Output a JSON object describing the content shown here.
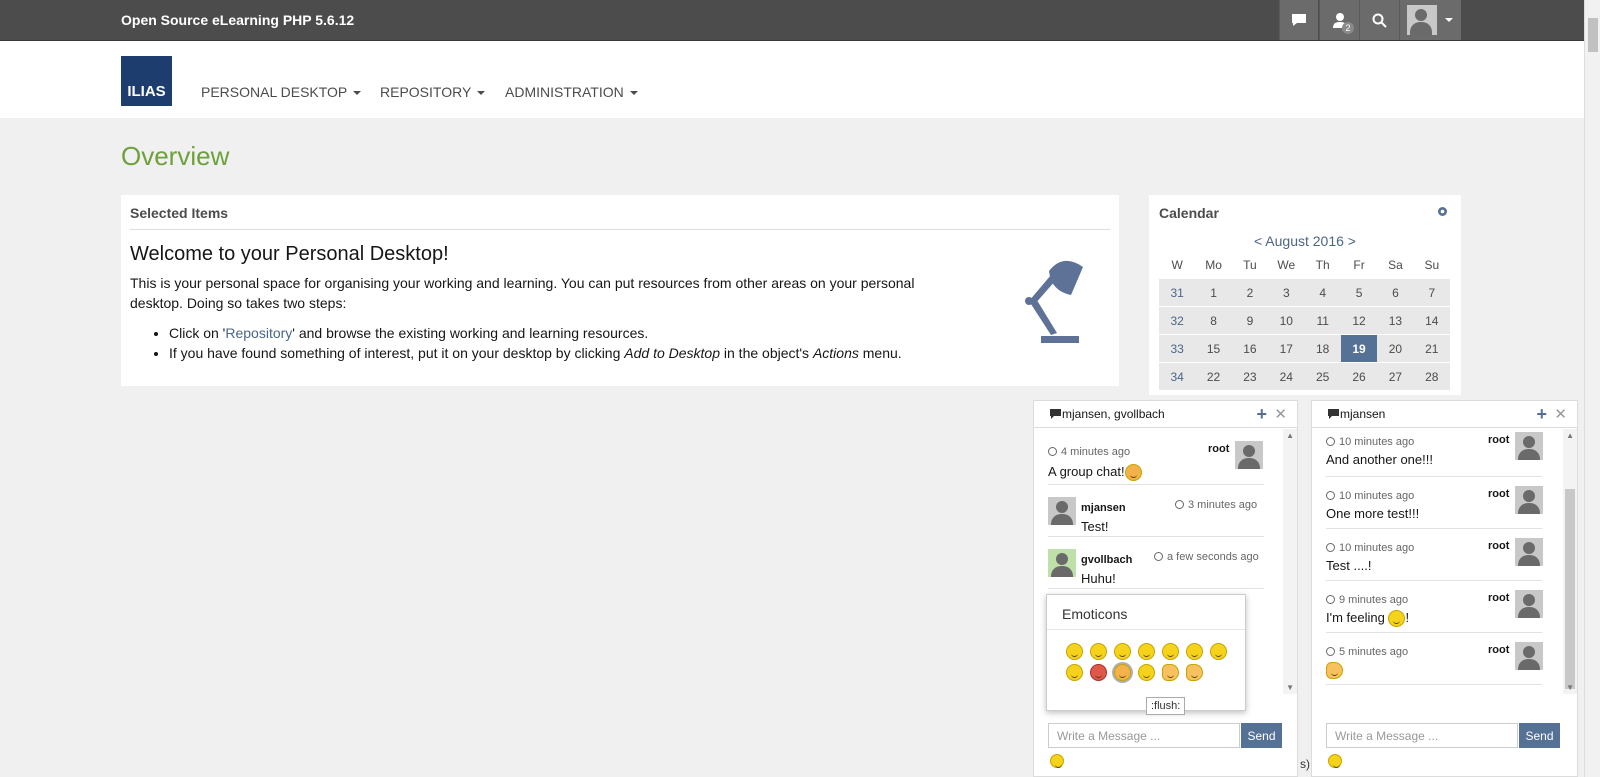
{
  "topbar": {
    "brand": "Open Source eLearning PHP 5.6.12",
    "icons": [
      "chat-icon",
      "user-icon",
      "search-icon",
      "avatar"
    ],
    "contacts_badge": "2"
  },
  "header": {
    "logo": "ILIAS",
    "nav": [
      "PERSONAL DESKTOP",
      "REPOSITORY",
      "ADMINISTRATION"
    ]
  },
  "page": {
    "title": "Overview"
  },
  "selected_items": {
    "title": "Selected Items",
    "welcome_heading": "Welcome to your Personal Desktop!",
    "welcome_text": "This is your personal space for organising your working and learning. You can put resources from other areas on your personal desktop. Doing so takes two steps:",
    "step1_a": "Click on '",
    "step1_link": "Repository",
    "step1_b": "' and browse the existing working and learning resources.",
    "step2_a": "If you have found something of interest, put it on your desktop by clicking ",
    "step2_em1": "Add to Desktop",
    "step2_b": " in the object's ",
    "step2_em2": "Actions",
    "step2_c": " menu."
  },
  "calendar": {
    "title": "Calendar",
    "month": "< August 2016 >",
    "headers": [
      "W",
      "Mo",
      "Tu",
      "We",
      "Th",
      "Fr",
      "Sa",
      "Su"
    ],
    "weeks": [
      [
        "31",
        "1",
        "2",
        "3",
        "4",
        "5",
        "6",
        "7"
      ],
      [
        "32",
        "8",
        "9",
        "10",
        "11",
        "12",
        "13",
        "14"
      ],
      [
        "33",
        "15",
        "16",
        "17",
        "18",
        "19",
        "20",
        "21"
      ],
      [
        "34",
        "22",
        "23",
        "24",
        "25",
        "26",
        "27",
        "28"
      ]
    ],
    "today": "19"
  },
  "chat_group": {
    "title": "mjansen, gvollbach",
    "messages": [
      {
        "time": "4 minutes ago",
        "user": "root",
        "text": "A group chat!"
      },
      {
        "time": "3 minutes ago",
        "user": "mjansen",
        "text": "Test!"
      },
      {
        "time": "a few seconds ago",
        "user": "gvollbach",
        "text": "Huhu!"
      }
    ],
    "input_placeholder": "Write a Message ...",
    "send_label": "Send"
  },
  "chat_single": {
    "title": "mjansen",
    "messages": [
      {
        "time": "10 minutes ago",
        "user": "root",
        "text": "And another one!!!"
      },
      {
        "time": "10 minutes ago",
        "user": "root",
        "text": "One more test!!!"
      },
      {
        "time": "10 minutes ago",
        "user": "root",
        "text": "Test ....!"
      },
      {
        "time": "9 minutes ago",
        "user": "root",
        "text": "I'm feeling"
      },
      {
        "time": "5 minutes ago",
        "user": "root",
        "text": ""
      }
    ],
    "input_placeholder": "Write a Message ...",
    "send_label": "Send"
  },
  "emoticons": {
    "title": "Emoticons",
    "tooltip": ":flush:",
    "hidden_fragment": "s)"
  }
}
